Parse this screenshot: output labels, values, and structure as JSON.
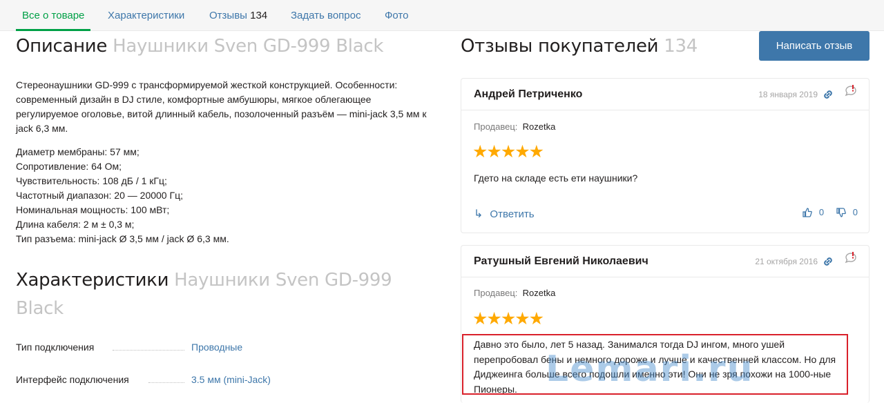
{
  "tabs": [
    {
      "label": "Все о товаре"
    },
    {
      "label": "Характеристики"
    },
    {
      "label": "Отзывы",
      "count": "134"
    },
    {
      "label": "Задать вопрос"
    },
    {
      "label": "Фото"
    }
  ],
  "description": {
    "title": "Описание",
    "product": "Наушники Sven GD-999 Black",
    "paragraph1": "Стереонаушники GD-999 с трансформируемой жесткой конструкцией. Особенности: современный дизайн в DJ стиле, комфортные амбушюры, мягкое облегающее регулируемое оголовье, витой длинный кабель, позолоченный разъём — mini-jack 3,5 мм к jack 6,3 мм.",
    "specs_lines": [
      "Диаметр мембраны: 57 мм;",
      "Сопротивление: 64 Ом;",
      "Чувствительность: 108 дБ / 1 кГц;",
      "Частотный диапазон: 20 — 20000 Гц;",
      "Номинальная мощность: 100 мВт;",
      "Длина кабеля: 2 м ± 0,3 м;",
      "Тип разъема: mini-jack Ø 3,5 мм / jack Ø 6,3 мм."
    ]
  },
  "characteristics": {
    "title": "Характеристики",
    "product_line1": "Наушники Sven GD-999",
    "product_line2": "Black",
    "rows": [
      {
        "label": "Тип подключения",
        "value": "Проводные"
      },
      {
        "label": "Интерфейс подключения",
        "value": "3.5 мм (mini-Jack)"
      }
    ]
  },
  "reviews": {
    "title": "Отзывы покупателей",
    "count": "134",
    "write_button": "Написать отзыв",
    "seller_label": "Продавец:",
    "items": [
      {
        "author": "Андрей Петриченко",
        "date": "18 января 2019",
        "seller": "Rozetka",
        "stars": "★★★★★",
        "text": "Гдето на складе есть ети наушники?",
        "reply": "Ответить",
        "likes": "0",
        "dislikes": "0"
      },
      {
        "author": "Ратушный Евгений Николаевич",
        "date": "21 октября 2016",
        "seller": "Rozetka",
        "stars": "★★★★★",
        "text": "Давно это было, лет 5 назад. Занимался тогда DJ ингом, много ушей перепробовал бены и немного дороже и лучше и качественней классом. Но для Диджеинга больше всего подошли именно эти! Они не зря похожи на 1000-ные Пионеры."
      }
    ]
  },
  "watermark": "Lemari.ru",
  "colors": {
    "link": "#3e77aa",
    "active": "#00a046",
    "stars": "#ffa900",
    "highlight": "#d9202a"
  },
  "icons": [
    "link-icon",
    "report-icon",
    "reply-arrow-icon",
    "thumbs-up-icon",
    "thumbs-down-icon"
  ]
}
